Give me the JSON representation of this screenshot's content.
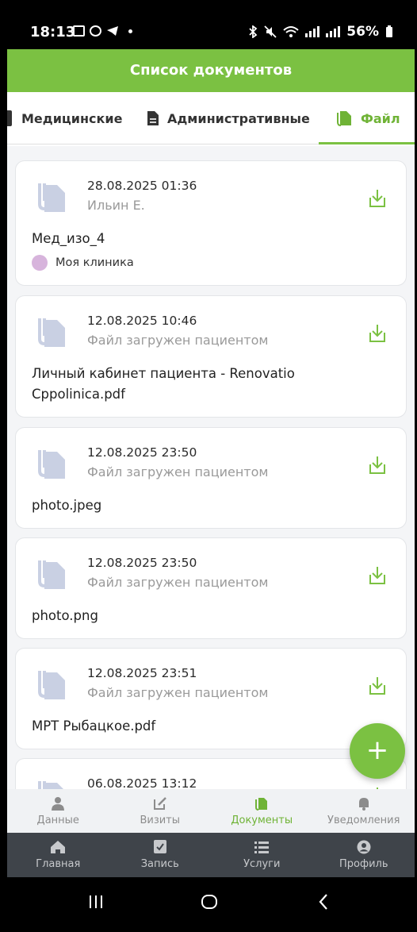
{
  "status_bar": {
    "time": "18:13",
    "battery": "56%"
  },
  "header": {
    "title": "Список документов"
  },
  "tabs": [
    {
      "label": "Медицинские",
      "icon": "medical-doc-icon"
    },
    {
      "label": "Административные",
      "icon": "document-icon"
    },
    {
      "label": "Файл",
      "icon": "file-icon",
      "active": true
    }
  ],
  "documents": [
    {
      "date": "28.08.2025 01:36",
      "subtitle": "Ильин Е.",
      "filename": "Мед_изо_4",
      "clinic": "Моя клиника"
    },
    {
      "date": "12.08.2025 10:46",
      "subtitle": "Файл загружен пациентом",
      "filename": "Личный кабинет пациента - Renovatio Cppolinica.pdf"
    },
    {
      "date": "12.08.2025 23:50",
      "subtitle": "Файл загружен пациентом",
      "filename": "photo.jpeg"
    },
    {
      "date": "12.08.2025 23:50",
      "subtitle": "Файл загружен пациентом",
      "filename": "photo.png"
    },
    {
      "date": "12.08.2025 23:51",
      "subtitle": "Файл загружен пациентом",
      "filename": "МРТ Рыбацкое.pdf"
    },
    {
      "date": "06.08.2025 13:12",
      "subtitle": "",
      "filename": ""
    }
  ],
  "fab": {
    "label": "+"
  },
  "subnav": [
    {
      "label": "Данные",
      "icon": "user-icon"
    },
    {
      "label": "Визиты",
      "icon": "edit-icon"
    },
    {
      "label": "Документы",
      "icon": "documents-icon",
      "active": true
    },
    {
      "label": "Уведомления",
      "icon": "bell-icon"
    }
  ],
  "mainnav": [
    {
      "label": "Главная",
      "icon": "home-icon"
    },
    {
      "label": "Запись",
      "icon": "checkbox-icon"
    },
    {
      "label": "Услуги",
      "icon": "list-icon"
    },
    {
      "label": "Профиль",
      "icon": "profile-icon"
    }
  ],
  "colors": {
    "accent": "#7bc142",
    "nav_dark": "#3f444a"
  }
}
